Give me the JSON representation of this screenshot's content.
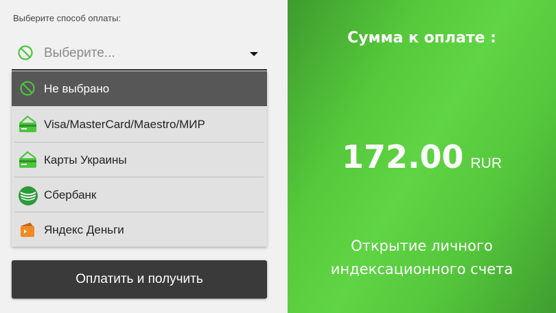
{
  "payment_form": {
    "label": "Выберите способ оплаты:",
    "select": {
      "placeholder": "Выберите...",
      "icon": "no-entry-icon"
    },
    "options": [
      {
        "label": "Не выбрано",
        "icon": "no-entry-icon",
        "highlighted": true
      },
      {
        "label": "Visa/MasterCard/Maestro/МИР",
        "icon": "card-icon"
      },
      {
        "label": "Карты Украины",
        "icon": "card-icon"
      },
      {
        "label": "Сбербанк",
        "icon": "sberbank-icon"
      },
      {
        "label": "Яндекс Деньги",
        "icon": "yandex-money-icon"
      }
    ],
    "submit_label": "Оплатить и получить"
  },
  "summary": {
    "title": "Сумма к оплате :",
    "amount": "172.00",
    "currency": "RUR",
    "description_line1": "Открытие личного",
    "description_line2": "индексационного счета"
  },
  "colors": {
    "accent_green": "#5fd444",
    "icon_green": "#4cc53d",
    "button_dark": "#3a3a3a",
    "highlight_gray": "#575757",
    "yandex_orange": "#f08a24"
  }
}
